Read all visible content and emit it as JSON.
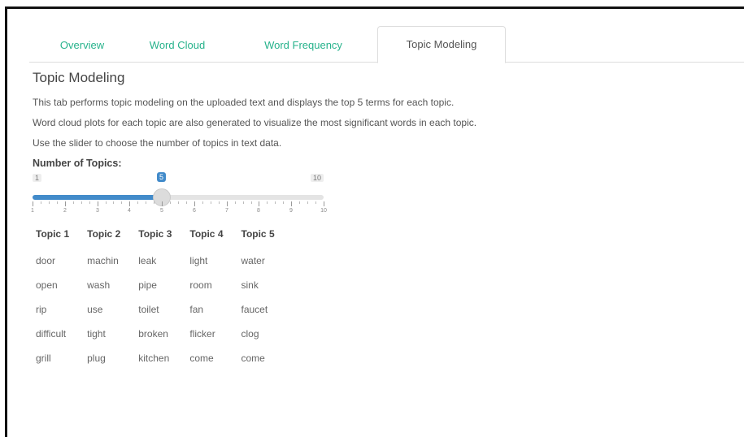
{
  "tabs": [
    {
      "label": "Overview",
      "active": false
    },
    {
      "label": "Word Cloud",
      "active": false
    },
    {
      "label": "Word Frequency",
      "active": false
    },
    {
      "label": "Topic Modeling",
      "active": true
    }
  ],
  "main": {
    "title": "Topic Modeling",
    "descriptions": [
      "This tab performs topic modeling on the uploaded text and displays the top 5 terms for each topic.",
      "Word cloud plots for each topic are also generated to visualize the most significant words in each topic.",
      "Use the slider to choose the number of topics in text data."
    ]
  },
  "slider": {
    "label": "Number of Topics:",
    "min": 1,
    "max": 10,
    "value": 5,
    "min_label": "1",
    "max_label": "10",
    "value_label": "5",
    "tick_labels": [
      "1",
      "2",
      "3",
      "4",
      "5",
      "6",
      "7",
      "8",
      "9",
      "10"
    ],
    "accent_color": "#428bca"
  },
  "table": {
    "headers": [
      "Topic 1",
      "Topic 2",
      "Topic 3",
      "Topic 4",
      "Topic 5"
    ],
    "rows": [
      [
        "door",
        "machin",
        "leak",
        "light",
        "water"
      ],
      [
        "open",
        "wash",
        "pipe",
        "room",
        "sink"
      ],
      [
        "rip",
        "use",
        "toilet",
        "fan",
        "faucet"
      ],
      [
        "difficult",
        "tight",
        "broken",
        "flicker",
        "clog"
      ],
      [
        "grill",
        "plug",
        "kitchen",
        "come",
        "come"
      ]
    ]
  },
  "colors": {
    "tab_link": "#26b28b",
    "tab_active_text": "#555555"
  }
}
